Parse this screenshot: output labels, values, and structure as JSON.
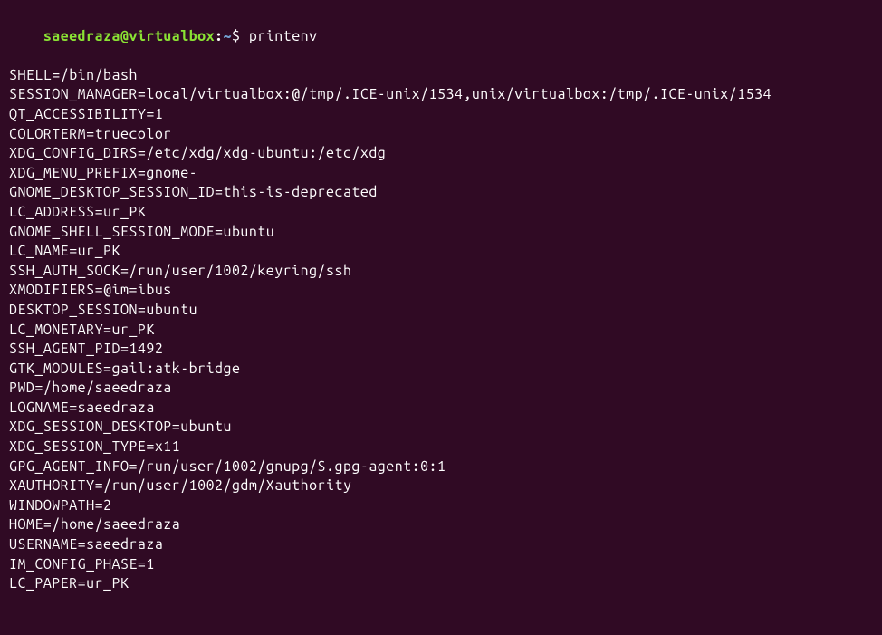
{
  "prompt": {
    "user_host": "saeedraza@virtualbox",
    "colon": ":",
    "path": "~",
    "dollar": "$ ",
    "command": "printenv"
  },
  "env": [
    "SHELL=/bin/bash",
    "SESSION_MANAGER=local/virtualbox:@/tmp/.ICE-unix/1534,unix/virtualbox:/tmp/.ICE-unix/1534",
    "QT_ACCESSIBILITY=1",
    "COLORTERM=truecolor",
    "XDG_CONFIG_DIRS=/etc/xdg/xdg-ubuntu:/etc/xdg",
    "XDG_MENU_PREFIX=gnome-",
    "GNOME_DESKTOP_SESSION_ID=this-is-deprecated",
    "LC_ADDRESS=ur_PK",
    "GNOME_SHELL_SESSION_MODE=ubuntu",
    "LC_NAME=ur_PK",
    "SSH_AUTH_SOCK=/run/user/1002/keyring/ssh",
    "XMODIFIERS=@im=ibus",
    "DESKTOP_SESSION=ubuntu",
    "LC_MONETARY=ur_PK",
    "SSH_AGENT_PID=1492",
    "GTK_MODULES=gail:atk-bridge",
    "PWD=/home/saeedraza",
    "LOGNAME=saeedraza",
    "XDG_SESSION_DESKTOP=ubuntu",
    "XDG_SESSION_TYPE=x11",
    "GPG_AGENT_INFO=/run/user/1002/gnupg/S.gpg-agent:0:1",
    "XAUTHORITY=/run/user/1002/gdm/Xauthority",
    "WINDOWPATH=2",
    "HOME=/home/saeedraza",
    "USERNAME=saeedraza",
    "IM_CONFIG_PHASE=1",
    "LC_PAPER=ur_PK"
  ]
}
